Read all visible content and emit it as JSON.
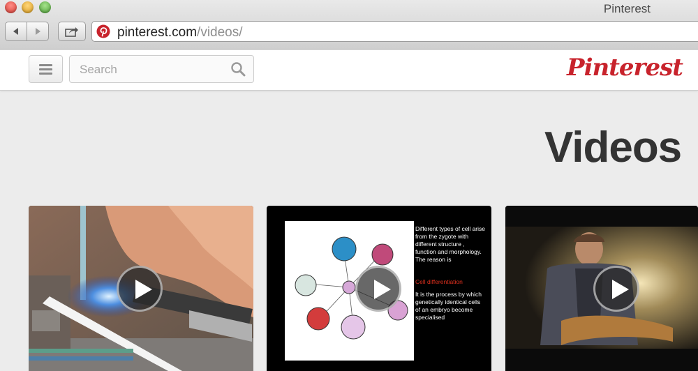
{
  "window": {
    "title": "Pinterest"
  },
  "address_bar": {
    "host": "pinterest.com",
    "path": "/videos/"
  },
  "header": {
    "search_placeholder": "Search",
    "logo": "Pinterest"
  },
  "page": {
    "title": "Videos"
  },
  "cards": [
    {
      "kind": "video",
      "icon": "play-icon"
    },
    {
      "kind": "video",
      "icon": "play-icon",
      "slide_text": {
        "intro": "Different types of cell arise from the zygote with different structure , function and morphology. The reason is",
        "term": "Cell differentiation",
        "definition": "It is the process by which genetically identical cells of an embryo become specialised"
      }
    },
    {
      "kind": "video",
      "icon": "play-icon"
    }
  ],
  "colors": {
    "brand": "#c8232c",
    "title_text": "#333333"
  },
  "icons": [
    "back-arrow-icon",
    "forward-arrow-icon",
    "share-icon",
    "pinterest-favicon-icon",
    "hamburger-menu-icon",
    "search-icon",
    "play-icon"
  ]
}
